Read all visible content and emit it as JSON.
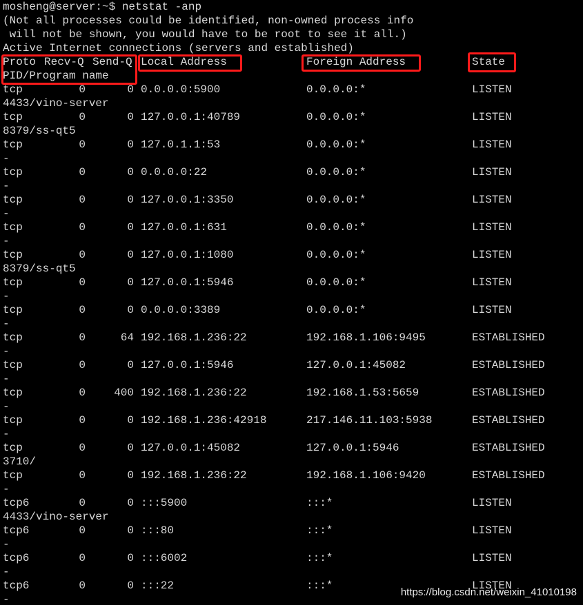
{
  "terminal": {
    "prompt": "mosheng@server:~$ netstat -anp",
    "intro": [
      "(Not all processes could be identified, non-owned process info",
      " will not be shown, you would have to be root to see it all.)",
      "Active Internet connections (servers and established)"
    ],
    "headers": {
      "proto": "Proto",
      "recvq": "Recv-Q",
      "sendq": "Send-Q",
      "local": "Local Address",
      "foreign": "Foreign Address",
      "state": "State",
      "pid": "PID/Program name"
    },
    "rows": [
      {
        "proto": "tcp",
        "recvq": "0",
        "sendq": "0",
        "local": "0.0.0.0:5900",
        "foreign": "0.0.0.0:*",
        "state": "LISTEN",
        "pid": "4433/vino-server"
      },
      {
        "proto": "tcp",
        "recvq": "0",
        "sendq": "0",
        "local": "127.0.0.1:40789",
        "foreign": "0.0.0.0:*",
        "state": "LISTEN",
        "pid": "8379/ss-qt5"
      },
      {
        "proto": "tcp",
        "recvq": "0",
        "sendq": "0",
        "local": "127.0.1.1:53",
        "foreign": "0.0.0.0:*",
        "state": "LISTEN",
        "pid": "-"
      },
      {
        "proto": "tcp",
        "recvq": "0",
        "sendq": "0",
        "local": "0.0.0.0:22",
        "foreign": "0.0.0.0:*",
        "state": "LISTEN",
        "pid": "-"
      },
      {
        "proto": "tcp",
        "recvq": "0",
        "sendq": "0",
        "local": "127.0.0.1:3350",
        "foreign": "0.0.0.0:*",
        "state": "LISTEN",
        "pid": "-"
      },
      {
        "proto": "tcp",
        "recvq": "0",
        "sendq": "0",
        "local": "127.0.0.1:631",
        "foreign": "0.0.0.0:*",
        "state": "LISTEN",
        "pid": "-"
      },
      {
        "proto": "tcp",
        "recvq": "0",
        "sendq": "0",
        "local": "127.0.0.1:1080",
        "foreign": "0.0.0.0:*",
        "state": "LISTEN",
        "pid": "8379/ss-qt5"
      },
      {
        "proto": "tcp",
        "recvq": "0",
        "sendq": "0",
        "local": "127.0.0.1:5946",
        "foreign": "0.0.0.0:*",
        "state": "LISTEN",
        "pid": "-"
      },
      {
        "proto": "tcp",
        "recvq": "0",
        "sendq": "0",
        "local": "0.0.0.0:3389",
        "foreign": "0.0.0.0:*",
        "state": "LISTEN",
        "pid": "-"
      },
      {
        "proto": "tcp",
        "recvq": "0",
        "sendq": "64",
        "local": "192.168.1.236:22",
        "foreign": "192.168.1.106:9495",
        "state": "ESTABLISHED",
        "pid": "-"
      },
      {
        "proto": "tcp",
        "recvq": "0",
        "sendq": "0",
        "local": "127.0.0.1:5946",
        "foreign": "127.0.0.1:45082",
        "state": "ESTABLISHED",
        "pid": "-"
      },
      {
        "proto": "tcp",
        "recvq": "0",
        "sendq": "400",
        "local": "192.168.1.236:22",
        "foreign": "192.168.1.53:5659",
        "state": "ESTABLISHED",
        "pid": "-"
      },
      {
        "proto": "tcp",
        "recvq": "0",
        "sendq": "0",
        "local": "192.168.1.236:42918",
        "foreign": "217.146.11.103:5938",
        "state": "ESTABLISHED",
        "pid": "-"
      },
      {
        "proto": "tcp",
        "recvq": "0",
        "sendq": "0",
        "local": "127.0.0.1:45082",
        "foreign": "127.0.0.1:5946",
        "state": "ESTABLISHED",
        "pid": "3710/"
      },
      {
        "proto": "tcp",
        "recvq": "0",
        "sendq": "0",
        "local": "192.168.1.236:22",
        "foreign": "192.168.1.106:9420",
        "state": "ESTABLISHED",
        "pid": "-"
      },
      {
        "proto": "tcp6",
        "recvq": "0",
        "sendq": "0",
        "local": ":::5900",
        "foreign": ":::*",
        "state": "LISTEN",
        "pid": "4433/vino-server"
      },
      {
        "proto": "tcp6",
        "recvq": "0",
        "sendq": "0",
        "local": ":::80",
        "foreign": ":::*",
        "state": "LISTEN",
        "pid": "-"
      },
      {
        "proto": "tcp6",
        "recvq": "0",
        "sendq": "0",
        "local": ":::6002",
        "foreign": ":::*",
        "state": "LISTEN",
        "pid": "-"
      },
      {
        "proto": "tcp6",
        "recvq": "0",
        "sendq": "0",
        "local": ":::22",
        "foreign": ":::*",
        "state": "LISTEN",
        "pid": "-"
      }
    ]
  },
  "watermark": "https://blog.csdn.net/weixin_41010198",
  "colors": {
    "background": "#000000",
    "text": "#d8d8d8",
    "highlight": "#ff1a1a"
  }
}
